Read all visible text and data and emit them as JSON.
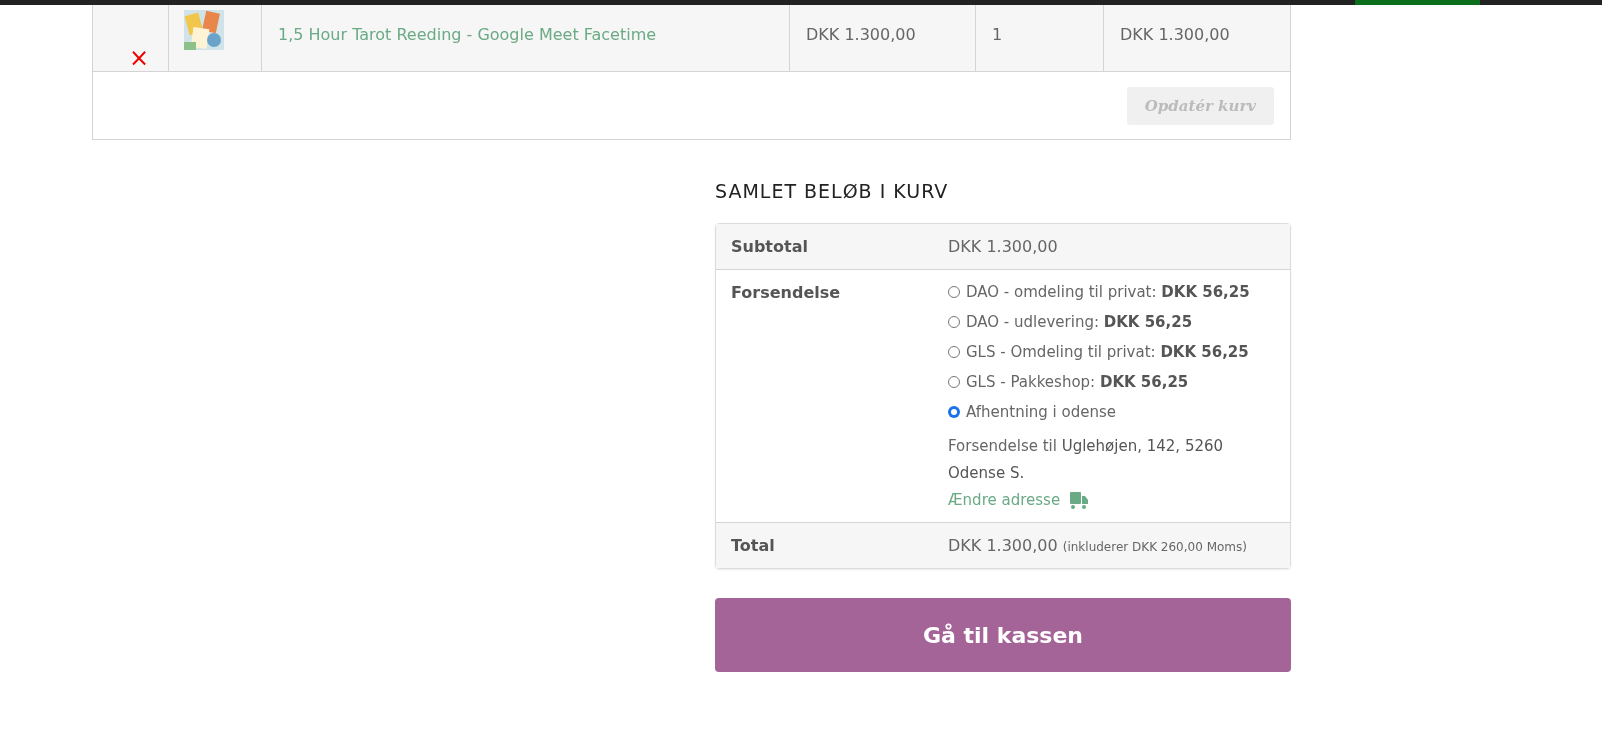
{
  "cart": {
    "items": [
      {
        "remove": "×",
        "product": "1,5 Hour Tarot Reeding - Google Meet Facetime",
        "price": "DKK 1.300,00",
        "quantity": "1",
        "subtotal": "DKK 1.300,00"
      }
    ],
    "update_button": {
      "label": "Opdatér kurv",
      "disabled": true
    }
  },
  "totals": {
    "heading": "SAMLET BELØB I KURV",
    "subtotal": {
      "label": "Subtotal",
      "value": "DKK 1.300,00"
    },
    "shipping": {
      "label": "Forsendelse",
      "options": [
        {
          "label": "DAO - omdeling til privat: **DKK 56,25**",
          "selected": false
        },
        {
          "label": "DAO - udlevering: **DKK 56,25**",
          "selected": false
        },
        {
          "label": "GLS - Omdeling til privat: **DKK 56,25**",
          "selected": false
        },
        {
          "label": "GLS - Pakkeshop: **DKK 56,25**",
          "selected": false
        },
        {
          "label": "Afhentning i odense",
          "selected": true
        }
      ],
      "destination": "Forsendelse til **Uglehøjen, 142, 5260 Odense S.**",
      "change_address": "Ændre adresse"
    },
    "total": {
      "label": "Total",
      "value": "DKK 1.300,00",
      "tax_note": "(inkluderer DKK 260,00 Moms)"
    },
    "checkout_button": "Gå til kassen"
  }
}
